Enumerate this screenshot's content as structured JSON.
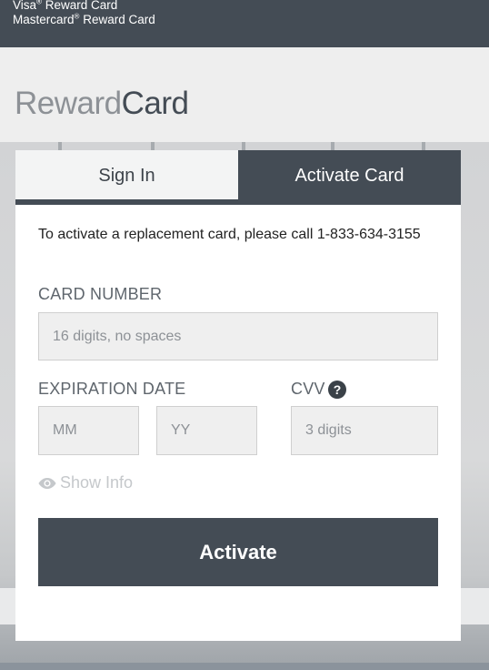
{
  "top_bar": {
    "line1_text": "Visa",
    "line1_suffix": " Reward Card",
    "line2_text": "Mastercard",
    "line2_suffix": " Reward Card",
    "registered_mark": "®"
  },
  "logo": {
    "part1": "Reward",
    "part2": "Card"
  },
  "tabs": [
    {
      "label": "Sign In",
      "active": false
    },
    {
      "label": "Activate Card",
      "active": true
    }
  ],
  "form": {
    "info_text": "To activate a replacement card, please call 1-833-634-3155",
    "card_number": {
      "label": "CARD NUMBER",
      "placeholder": "16 digits, no spaces"
    },
    "expiration": {
      "label": "EXPIRATION DATE",
      "month_placeholder": "MM",
      "year_placeholder": "YY"
    },
    "cvv": {
      "label": "CVV",
      "placeholder": "3 digits",
      "help_icon": "question-circle-icon"
    },
    "show_info": {
      "label": "Show Info",
      "icon": "eye-icon"
    },
    "submit_label": "Activate"
  },
  "colors": {
    "dark_slate": "#444c55",
    "logo_gray": "#8d9196",
    "field_bg": "#efefef"
  }
}
